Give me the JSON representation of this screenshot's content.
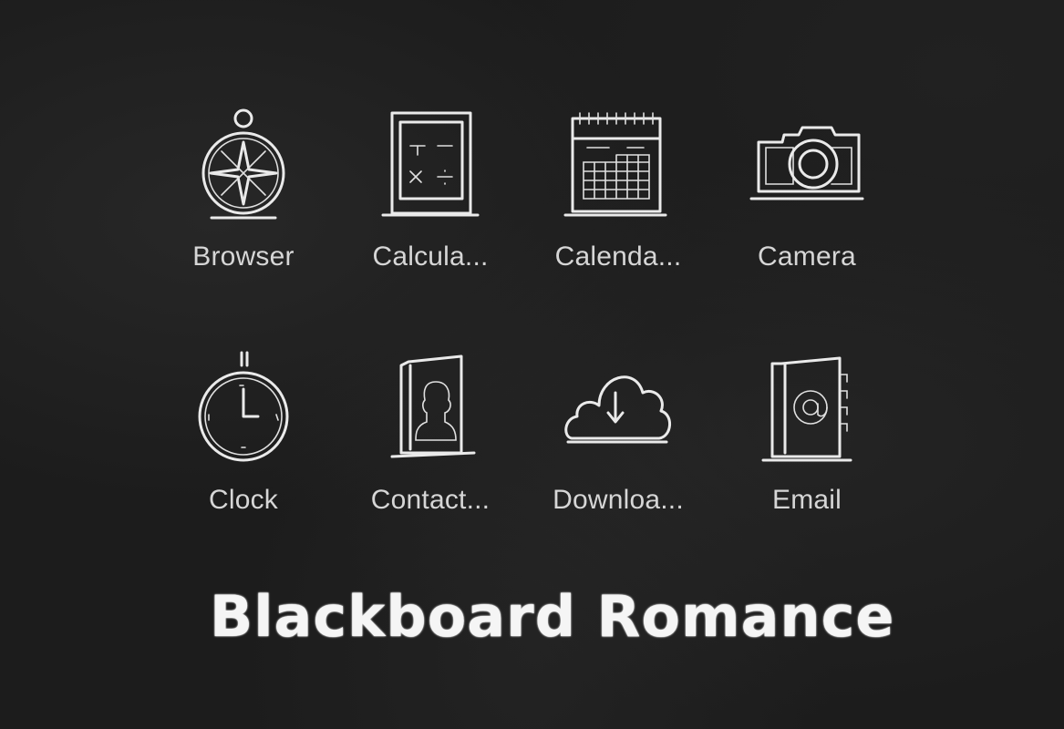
{
  "apps": [
    {
      "label": "Browser",
      "icon": "compass-icon"
    },
    {
      "label": "Calcula...",
      "icon": "calculator-icon"
    },
    {
      "label": "Calenda...",
      "icon": "calendar-icon"
    },
    {
      "label": "Camera",
      "icon": "camera-icon"
    },
    {
      "label": "Clock",
      "icon": "clock-icon"
    },
    {
      "label": "Contact...",
      "icon": "contacts-icon"
    },
    {
      "label": "Downloa...",
      "icon": "cloud-download-icon"
    },
    {
      "label": "Email",
      "icon": "email-icon"
    }
  ],
  "theme_title": "Blackboard Romance",
  "colors": {
    "background": "#1c1c1c",
    "label": "#d6d6d6",
    "chalk": "#eaeaea"
  }
}
